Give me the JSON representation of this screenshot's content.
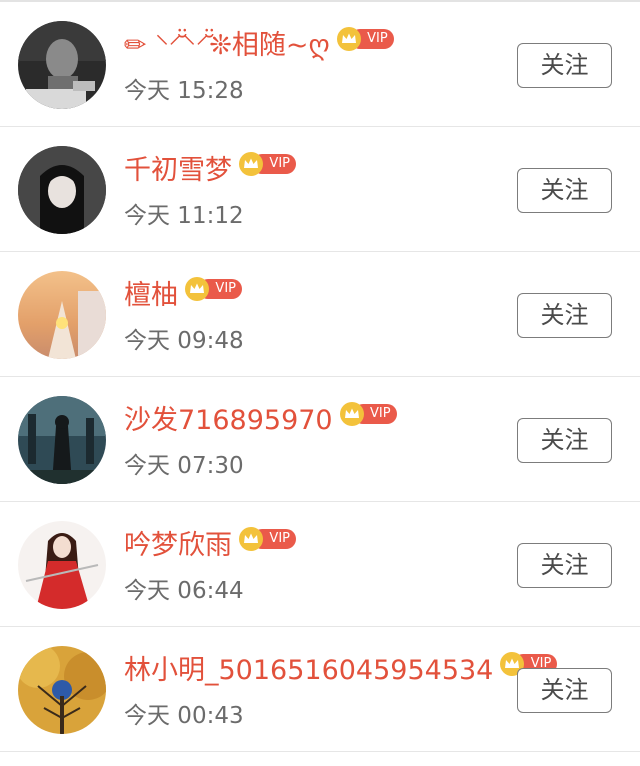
{
  "list": {
    "items": [
      {
        "name": "✏ ⸌⸍̆̈⸌⸍̆̈❊相随~ღ",
        "vip": "VIP",
        "time": "今天 15:28",
        "follow": "关注"
      },
      {
        "name": "千初雪梦",
        "vip": "VIP",
        "time": "今天 11:12",
        "follow": "关注"
      },
      {
        "name": "檀柚",
        "vip": "VIP",
        "time": "今天 09:48",
        "follow": "关注"
      },
      {
        "name": "沙发716895970",
        "vip": "VIP",
        "time": "今天 07:30",
        "follow": "关注"
      },
      {
        "name": "吟梦欣雨",
        "vip": "VIP",
        "time": "今天 06:44",
        "follow": "关注"
      },
      {
        "name": "林小明_5016516045954534",
        "vip": "VIP",
        "time": "今天 00:43",
        "follow": "关注"
      }
    ]
  },
  "colors": {
    "name": "#e2513b",
    "vip_badge": "#ea5a4a",
    "crown": "#f3c23b",
    "time": "#6b6b6b",
    "button_border": "#7c7c7c",
    "divider": "#e6e6e6"
  },
  "icons": {
    "vip": "crown-icon"
  }
}
